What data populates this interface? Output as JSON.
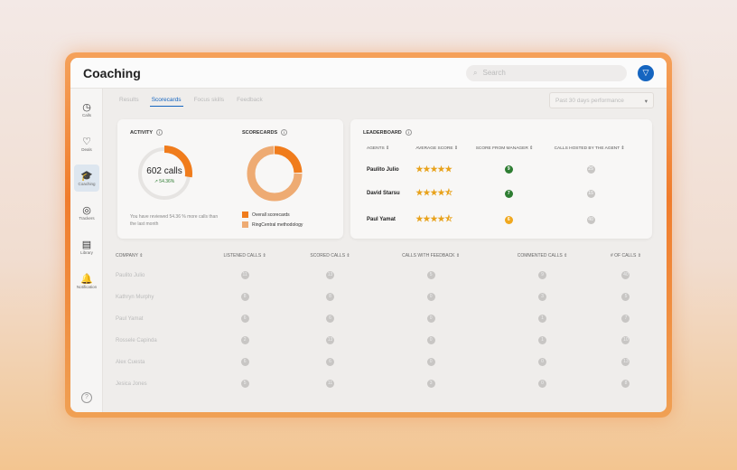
{
  "header": {
    "title": "Coaching",
    "search_placeholder": "Search",
    "filter_icon": "filter-icon"
  },
  "sidebar": [
    {
      "label": "Calls",
      "icon": "clock-icon"
    },
    {
      "label": "Deals",
      "icon": "handshake-icon"
    },
    {
      "label": "Coaching",
      "icon": "coaching-icon",
      "active": true
    },
    {
      "label": "Trackers",
      "icon": "target-icon"
    },
    {
      "label": "Library",
      "icon": "library-icon"
    },
    {
      "label": "Notification",
      "icon": "bell-icon"
    }
  ],
  "help": "?",
  "tabs": [
    {
      "label": "Results"
    },
    {
      "label": "Scorecards",
      "active": true
    },
    {
      "label": "Focus skills"
    },
    {
      "label": "Feedback"
    }
  ],
  "period": {
    "value": "Past 30 days performance"
  },
  "activity": {
    "title": "ACTIVITY",
    "calls": "602 calls",
    "change": "↗ 54.36%",
    "progress_pct": 54.36,
    "note": "You have reviewed 54.36 % more calls than the last month"
  },
  "scorecards": {
    "title": "SCORECARDS",
    "slices": [
      {
        "label": "Overall scorecards",
        "value": 25,
        "color": "#f07c1c"
      },
      {
        "label": "RingCentral methodology",
        "value": 75,
        "color": "#eeab73"
      }
    ]
  },
  "leaderboard": {
    "title": "LEADERBOARD",
    "columns": [
      "AGENTS ⇕",
      "AVERAGE SCORE ⇕",
      "SCORE FROM MANAGER ⇕",
      "CALLS HOSTED BY THE AGENT ⇕"
    ],
    "rows": [
      {
        "agent": "Paulito Julio",
        "stars": "★★★★★",
        "rating": 5,
        "manager": "9",
        "manager_color": "#2e7d32",
        "calls": "25"
      },
      {
        "agent": "David Starsu",
        "stars": "★★★★⯪",
        "rating": 4.5,
        "manager": "7",
        "manager_color": "#2e7d32",
        "calls": "15"
      },
      {
        "agent": "Paul Yamat",
        "stars": "★★★★⯪",
        "rating": 4.5,
        "manager": "6",
        "manager_color": "#f0a81e",
        "calls": "40"
      }
    ]
  },
  "table": {
    "columns": [
      "COMPANY ⇕",
      "LISTENED CALLS ⇕",
      "SCORED CALLS ⇕",
      "CALLS WITH FEEDBACK ⇕",
      "COMMENTED CALLS ⇕",
      "# OF CALLS ⇕"
    ],
    "rows": [
      [
        "Paulito Julio",
        "11",
        "13",
        "5",
        "9",
        "40"
      ],
      [
        "Kathryn Murphy",
        "8",
        "8",
        "0",
        "3",
        "5"
      ],
      [
        "Paul Yamat",
        "6",
        "6",
        "0",
        "1",
        "7"
      ],
      [
        "Rossele Capinda",
        "2",
        "13",
        "0",
        "1",
        "10"
      ],
      [
        "Alex Cuesta",
        "6",
        "6",
        "0",
        "0",
        "13"
      ],
      [
        "Jesica Jones",
        "5",
        "11",
        "3",
        "0",
        "8"
      ]
    ]
  }
}
